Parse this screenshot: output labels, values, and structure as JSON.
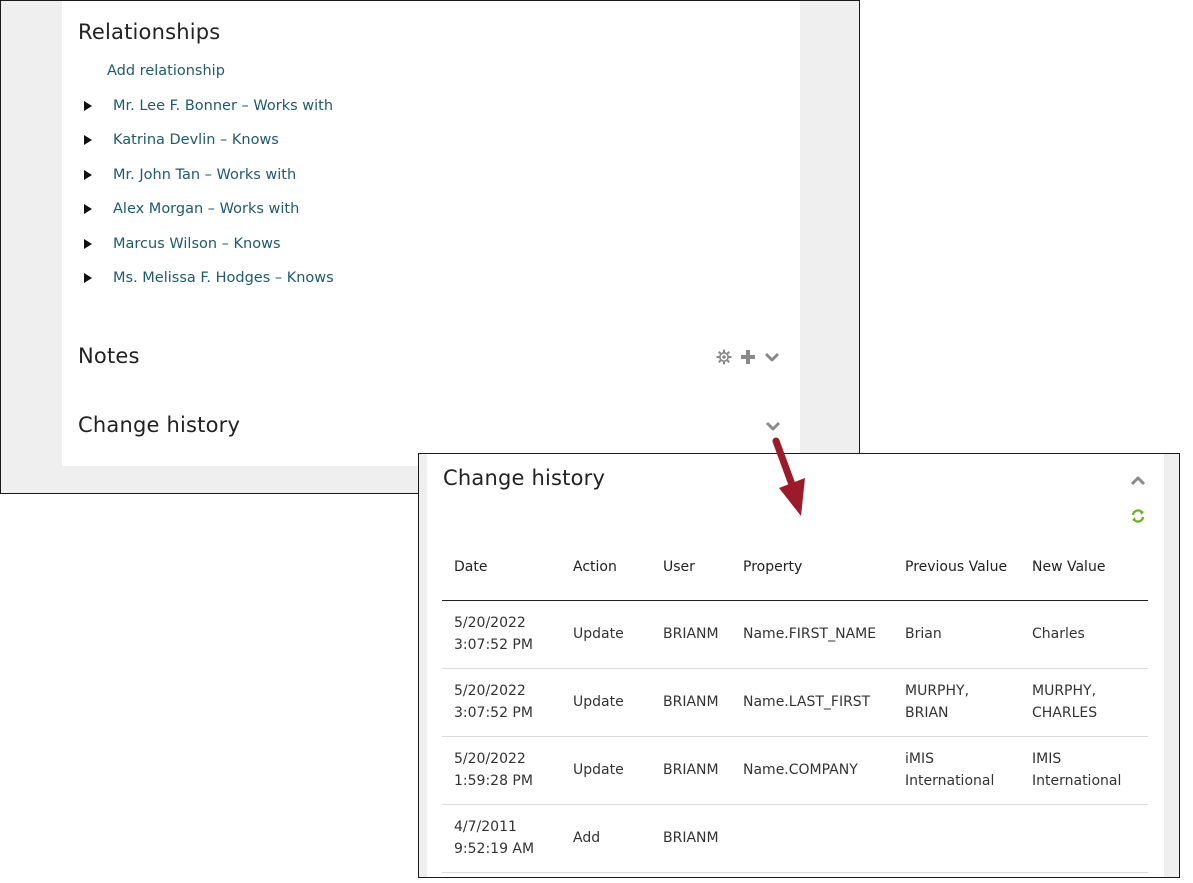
{
  "relationships": {
    "title": "Relationships",
    "add_label": "Add relationship",
    "items": [
      "Mr. Lee F. Bonner – Works with",
      "Katrina Devlin – Knows",
      "Mr. John Tan – Works with",
      "Alex Morgan – Works with",
      "Marcus Wilson – Knows",
      "Ms. Melissa F. Hodges – Knows"
    ]
  },
  "notes": {
    "title": "Notes",
    "icons": [
      "gear-icon",
      "plus-icon",
      "chevron-down-icon"
    ]
  },
  "change_history_collapsed": {
    "title": "Change history",
    "icons": [
      "chevron-down-icon"
    ]
  },
  "change_history_expanded": {
    "title": "Change history",
    "icons": [
      "chevron-up-icon",
      "refresh-icon"
    ],
    "columns": [
      "Date",
      "Action",
      "User",
      "Property",
      "Previous Value",
      "New Value"
    ],
    "rows": [
      {
        "date": "5/20/2022",
        "time": "3:07:52 PM",
        "action": "Update",
        "user": "BRIANM",
        "property": "Name.FIRST_NAME",
        "previous": "Brian",
        "new": "Charles"
      },
      {
        "date": "5/20/2022",
        "time": "3:07:52 PM",
        "action": "Update",
        "user": "BRIANM",
        "property": "Name.LAST_FIRST",
        "previous": "MURPHY, BRIAN",
        "new": "MURPHY, CHARLES"
      },
      {
        "date": "5/20/2022",
        "time": "1:59:28 PM",
        "action": "Update",
        "user": "BRIANM",
        "property": "Name.COMPANY",
        "previous": "iMIS International",
        "new": "IMIS International"
      },
      {
        "date": "4/7/2011",
        "time": "9:52:19 AM",
        "action": "Add",
        "user": "BRIANM",
        "property": "",
        "previous": "",
        "new": ""
      }
    ]
  },
  "colors": {
    "link": "#1f5a6e",
    "arrow": "#9b1b2a",
    "refresh": "#6ab023",
    "icon": "#8a8a8a"
  }
}
